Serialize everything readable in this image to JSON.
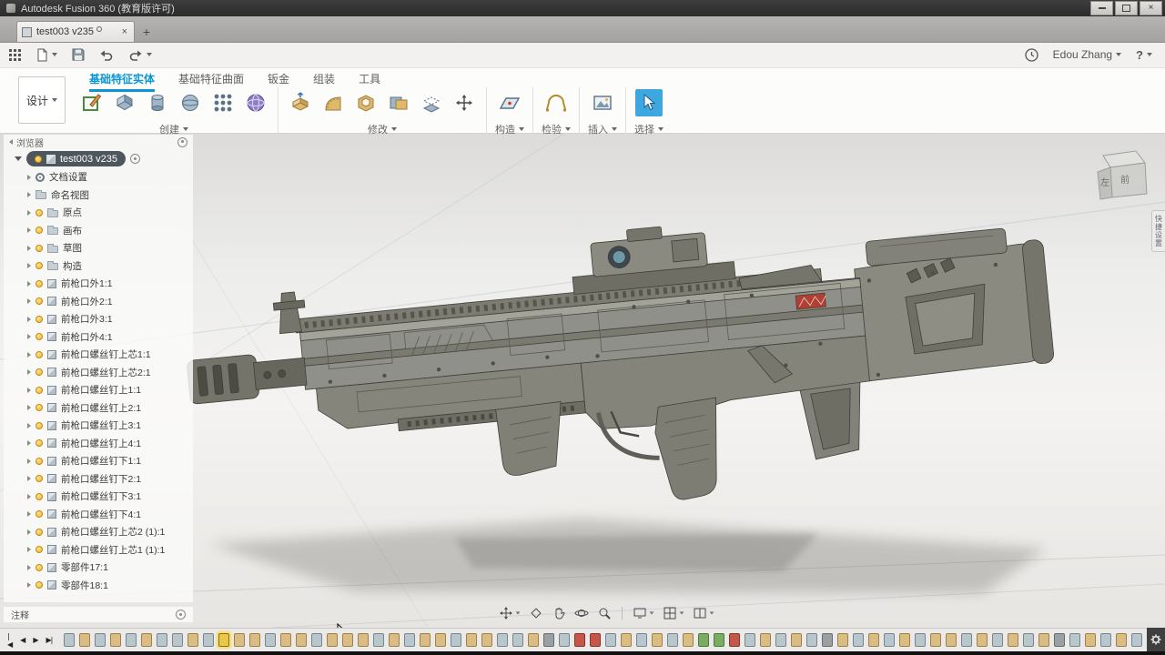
{
  "window": {
    "title": "Autodesk Fusion 360 (教育版许可)",
    "close_glyph": "×"
  },
  "document_tab": {
    "title": "test003 v235",
    "close_glyph": "×",
    "new_tab_glyph": "+"
  },
  "account": {
    "user": "Edou Zhang",
    "help_glyph": "?"
  },
  "workspace": {
    "label": "设计"
  },
  "ribbon": {
    "tabs": [
      "基础特征实体",
      "基础特征曲面",
      "钣金",
      "组装",
      "工具"
    ],
    "active_tab_index": 0,
    "groups": [
      {
        "label": "创建"
      },
      {
        "label": "修改"
      },
      {
        "label": "构造"
      },
      {
        "label": "检验"
      },
      {
        "label": "插入"
      },
      {
        "label": "选择"
      }
    ]
  },
  "browser": {
    "header": "浏览器",
    "root": {
      "label": "test003 v235"
    },
    "items": [
      {
        "label": "文档设置",
        "icon": "gear",
        "bulb": false
      },
      {
        "label": "命名视图",
        "icon": "folder",
        "bulb": false
      },
      {
        "label": "原点",
        "icon": "folder",
        "bulb": true
      },
      {
        "label": "画布",
        "icon": "folder",
        "bulb": true
      },
      {
        "label": "草图",
        "icon": "folder",
        "bulb": true
      },
      {
        "label": "构造",
        "icon": "folder",
        "bulb": true
      },
      {
        "label": "前枪口外1:1",
        "icon": "comp",
        "bulb": true
      },
      {
        "label": "前枪口外2:1",
        "icon": "comp",
        "bulb": true
      },
      {
        "label": "前枪口外3:1",
        "icon": "comp",
        "bulb": true
      },
      {
        "label": "前枪口外4:1",
        "icon": "comp",
        "bulb": true
      },
      {
        "label": "前枪口螺丝钉上芯1:1",
        "icon": "comp",
        "bulb": true
      },
      {
        "label": "前枪口螺丝钉上芯2:1",
        "icon": "comp",
        "bulb": true
      },
      {
        "label": "前枪口螺丝钉上1:1",
        "icon": "comp",
        "bulb": true
      },
      {
        "label": "前枪口螺丝钉上2:1",
        "icon": "comp",
        "bulb": true
      },
      {
        "label": "前枪口螺丝钉上3:1",
        "icon": "comp",
        "bulb": true
      },
      {
        "label": "前枪口螺丝钉上4:1",
        "icon": "comp",
        "bulb": true
      },
      {
        "label": "前枪口螺丝钉下1:1",
        "icon": "comp",
        "bulb": true
      },
      {
        "label": "前枪口螺丝钉下2:1",
        "icon": "comp",
        "bulb": true
      },
      {
        "label": "前枪口螺丝钉下3:1",
        "icon": "comp",
        "bulb": true
      },
      {
        "label": "前枪口螺丝钉下4:1",
        "icon": "comp",
        "bulb": true
      },
      {
        "label": "前枪口螺丝钉上芯2 (1):1",
        "icon": "comp",
        "bulb": true
      },
      {
        "label": "前枪口螺丝钉上芯1 (1):1",
        "icon": "comp",
        "bulb": true
      },
      {
        "label": "零部件17:1",
        "icon": "comp",
        "bulb": true
      },
      {
        "label": "零部件18:1",
        "icon": "comp",
        "bulb": true
      }
    ]
  },
  "comments": {
    "label": "注释"
  },
  "viewcube": {
    "front": "前",
    "left": "左"
  },
  "right_tab": {
    "label": "快捷设置"
  },
  "timeline": {
    "controls": [
      "|◀",
      "◀",
      "▶",
      "▶|"
    ],
    "pattern": "sfsfsfssfsyffsffsfffsfsffsffssfdsrrsfsfsfggrsfsfsdfsfsfsffsfsfsfdsfsfsfsfsfs"
  }
}
